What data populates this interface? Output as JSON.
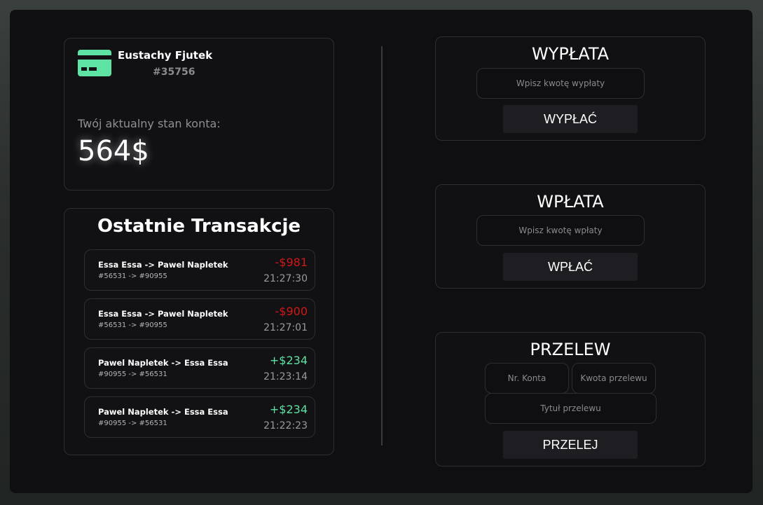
{
  "account": {
    "name": "Eustachy Fjutek",
    "number": "#35756",
    "balance_label": "Twój aktualny stan konta:",
    "balance": "564$",
    "card_icon": "credit-card-icon",
    "accent_color": "#5ee3a5"
  },
  "transactions": {
    "title": "Ostatnie Transakcje",
    "items": [
      {
        "parties": "Essa Essa -> Pawel Napletek",
        "accounts": "#56531 -> #90955",
        "amount": "-$981",
        "time": "21:27:30",
        "direction": "out"
      },
      {
        "parties": "Essa Essa -> Pawel Napletek",
        "accounts": "#56531 -> #90955",
        "amount": "-$900",
        "time": "21:27:01",
        "direction": "out"
      },
      {
        "parties": "Pawel Napletek -> Essa Essa",
        "accounts": "#90955 -> #56531",
        "amount": "+$234",
        "time": "21:23:14",
        "direction": "in"
      },
      {
        "parties": "Pawel Napletek -> Essa Essa",
        "accounts": "#90955 -> #56531",
        "amount": "+$234",
        "time": "21:22:23",
        "direction": "in"
      }
    ],
    "negative_color": "#d01818",
    "positive_color": "#5ee3a5"
  },
  "withdraw": {
    "title": "WYPŁATA",
    "amount_placeholder": "Wpisz kwotę wypłaty",
    "amount_value": "",
    "button_label": "WYPŁAĆ"
  },
  "deposit": {
    "title": "WPŁATA",
    "amount_placeholder": "Wpisz kwotę wpłaty",
    "amount_value": "",
    "button_label": "WPŁAĆ"
  },
  "transfer": {
    "title": "PRZELEW",
    "account_placeholder": "Nr. Konta",
    "amount_placeholder": "Kwota przelewu",
    "subject_placeholder": "Tytuł przelewu",
    "button_label": "PRZELEJ"
  }
}
